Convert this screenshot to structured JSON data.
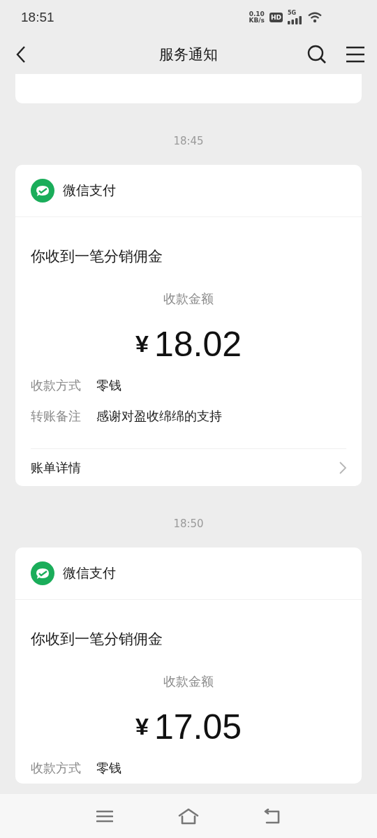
{
  "status_bar": {
    "time": "18:51",
    "speed_value": "0.10",
    "speed_unit": "KB/s",
    "hd": "HD",
    "network": "5G"
  },
  "header": {
    "title": "服务通知"
  },
  "messages": [
    {
      "time": "18:45",
      "app_name": "微信支付",
      "title": "你收到一笔分销佣金",
      "amount_label": "收款金额",
      "currency": "¥",
      "amount": "18.02",
      "fields": [
        {
          "label": "收款方式",
          "value": "零钱"
        },
        {
          "label": "转账备注",
          "value": "感谢对盈收绵绵的支持"
        }
      ],
      "link": "账单详情"
    },
    {
      "time": "18:50",
      "app_name": "微信支付",
      "title": "你收到一笔分销佣金",
      "amount_label": "收款金额",
      "currency": "¥",
      "amount": "17.05",
      "fields": [
        {
          "label": "收款方式",
          "value": "零钱"
        }
      ]
    }
  ]
}
